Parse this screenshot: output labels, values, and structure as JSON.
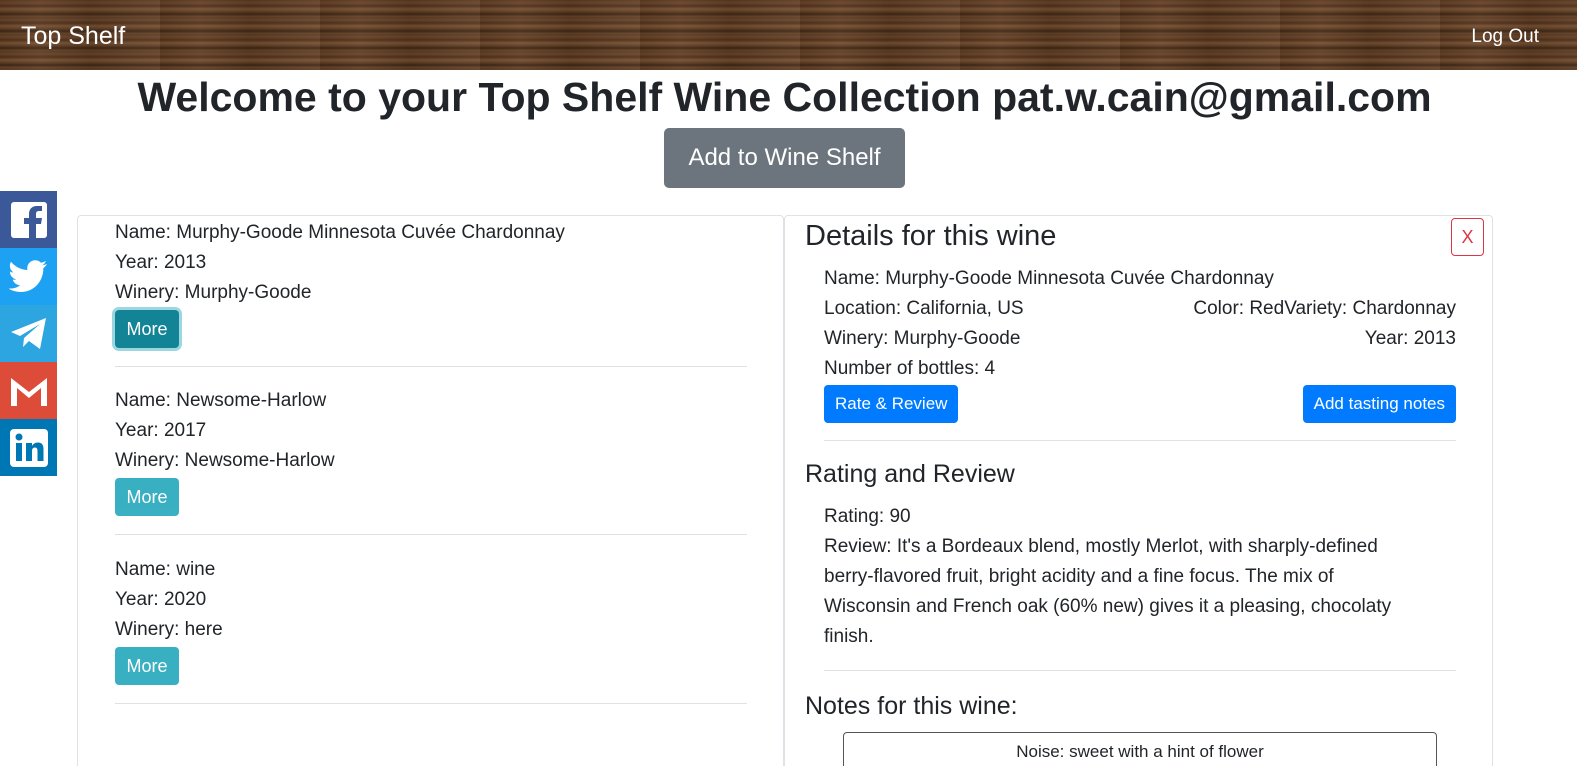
{
  "nav": {
    "brand": "Top Shelf",
    "logout": "Log Out"
  },
  "welcome": "Welcome to your Top Shelf Wine Collection pat.w.cain@gmail.com",
  "add_button": "Add to Wine Shelf",
  "social_icons": [
    "facebook-icon",
    "twitter-icon",
    "telegram-icon",
    "gmail-icon",
    "linkedin-icon"
  ],
  "wines": [
    {
      "name": "Name: Murphy-Goode Minnesota Cuvée Chardonnay",
      "year": "Year: 2013",
      "winery": "Winery: Murphy-Goode",
      "more": "More"
    },
    {
      "name": "Name: Newsome-Harlow",
      "year": "Year: 2017",
      "winery": "Winery: Newsome-Harlow",
      "more": "More"
    },
    {
      "name": "Name: wine",
      "year": "Year: 2020",
      "winery": "Winery: here",
      "more": "More"
    }
  ],
  "details": {
    "title": "Details for this wine",
    "close": "X",
    "name": "Name: Murphy-Goode Minnesota Cuvée Chardonnay",
    "location": "Location: California, US",
    "color_variety": "Color: RedVariety: Chardonnay",
    "winery": "Winery: Murphy-Goode",
    "year": "Year: 2013",
    "bottles": "Number of bottles: 4",
    "rate_button": "Rate & Review",
    "notes_button": "Add tasting notes"
  },
  "rating": {
    "title": "Rating and Review",
    "rating": "Rating: 90",
    "review": "Review: It's a Bordeaux blend, mostly Merlot, with sharply-defined berry-flavored fruit, bright acidity and a fine focus. The mix of Wisconsin and French oak (60% new) gives it a pleasing, chocolaty finish."
  },
  "notes": {
    "title": "Notes for this wine:",
    "first_note": "Noise: sweet with a hint of flower"
  },
  "colors": {
    "primary": "#007bff",
    "info": "#17a2b8",
    "secondary": "#6c757d",
    "danger": "#dc3545"
  }
}
